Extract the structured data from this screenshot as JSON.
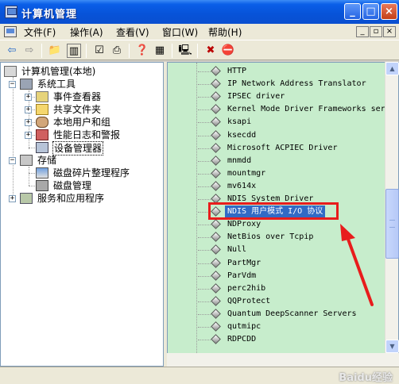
{
  "window": {
    "title": "计算机管理"
  },
  "menu": {
    "items": [
      "文件(F)",
      "操作(A)",
      "查看(V)",
      "窗口(W)",
      "帮助(H)"
    ]
  },
  "tree": {
    "root": "计算机管理(本地)",
    "system_tools": "系统工具",
    "event_viewer": "事件查看器",
    "shared_folders": "共享文件夹",
    "local_users": "本地用户和组",
    "perf_logs": "性能日志和警报",
    "device_manager": "设备管理器",
    "storage": "存储",
    "defrag": "磁盘碎片整理程序",
    "disk_mgmt": "磁盘管理",
    "services": "服务和应用程序"
  },
  "devices": {
    "items": [
      "HTTP",
      "IP Network Address Translator",
      "IPSEC driver",
      "Kernel Mode Driver Frameworks ser",
      "ksapi",
      "ksecdd",
      "Microsoft ACPIEC Driver",
      "mnmdd",
      "mountmgr",
      "mv614x",
      "NDIS System Driver",
      "NDIS 用户模式 I/O 协议",
      "NDProxy",
      "NetBios over Tcpip",
      "Null",
      "PartMgr",
      "ParVdm",
      "perc2hib",
      "QQProtect",
      "Quantum DeepScanner Servers",
      "qutmipc",
      "RDPCDD"
    ],
    "selected_index": 11
  },
  "watermark": "Baidu经验",
  "colors": {
    "title_blue": "#0a5ee8",
    "pane_green": "#c7edcc",
    "selection_blue": "#316ac5",
    "highlight_red": "#e81c1c"
  }
}
